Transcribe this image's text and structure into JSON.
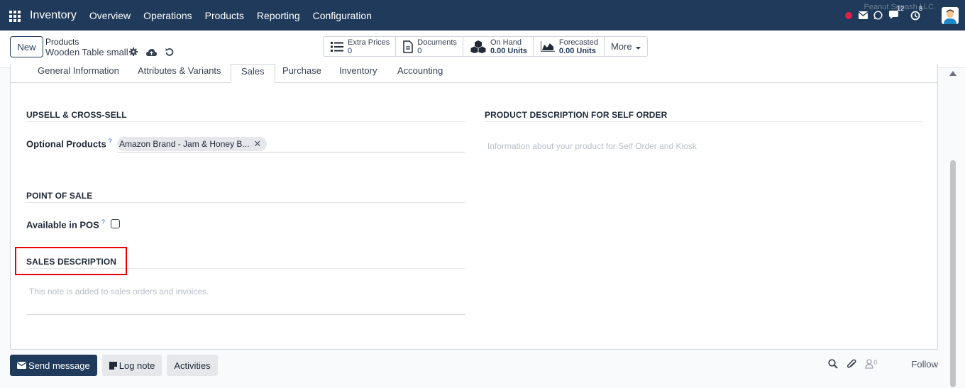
{
  "topnav": {
    "app_name": "Inventory",
    "menu": [
      "Overview",
      "Operations",
      "Products",
      "Reporting",
      "Configuration"
    ],
    "messages_badge": "12",
    "activities_badge": "8",
    "company": "Peanut Squash LLC"
  },
  "control": {
    "new_label": "New",
    "breadcrumb_parent": "Products",
    "breadcrumb_current": "Wooden Table small",
    "smart_buttons": [
      {
        "label": "Extra Prices",
        "value": "0",
        "icon": "list-icon"
      },
      {
        "label": "Documents",
        "value": "0",
        "icon": "document-icon"
      },
      {
        "label": "On Hand",
        "value": "0.00 Units",
        "icon": "cubes-icon"
      },
      {
        "label": "Forecasted",
        "value": "0.00 Units",
        "icon": "area-chart-icon"
      }
    ],
    "more_label": "More"
  },
  "tabs": [
    "General Information",
    "Attributes & Variants",
    "Sales",
    "Purchase",
    "Inventory",
    "Accounting"
  ],
  "active_tab": "Sales",
  "upsell": {
    "title": "UPSELL & CROSS-SELL",
    "optional_products_label": "Optional Products",
    "help_mark": "?",
    "optional_product_tag": "Amazon Brand - Jam & Honey B..."
  },
  "pos": {
    "title": "POINT OF SALE",
    "available_label": "Available in POS",
    "help_mark": "?",
    "available_checked": false
  },
  "sales_description": {
    "title": "SALES DESCRIPTION",
    "placeholder": "This note is added to sales orders and invoices."
  },
  "self_order": {
    "title": "PRODUCT DESCRIPTION FOR SELF ORDER",
    "placeholder": "Information about your product for Self Order and Kiosk"
  },
  "chatter": {
    "send_message": "Send message",
    "log_note": "Log note",
    "activities": "Activities",
    "followers_count": "0",
    "follow": "Follow"
  },
  "colors": {
    "nav": "#1f3a5a",
    "highlight": "#ee0000",
    "accent": "#2563eb"
  }
}
